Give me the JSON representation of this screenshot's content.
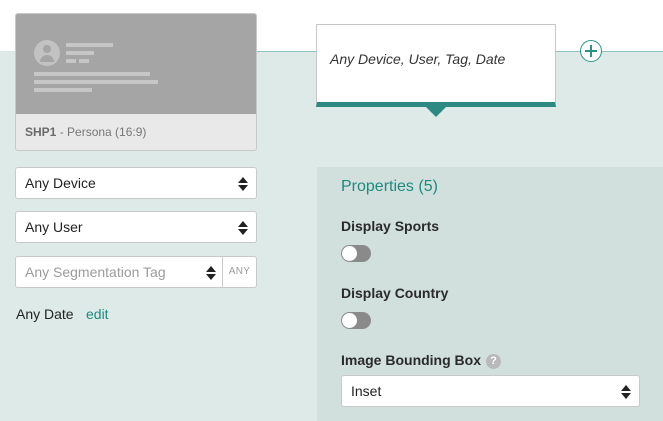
{
  "card": {
    "id": "SHP1",
    "caption_rest": " - Persona (16:9)"
  },
  "filters": {
    "device": "Any Device",
    "user": "Any User",
    "segmentation_placeholder": "Any Segmentation Tag",
    "any_badge": "ANY",
    "date": "Any Date",
    "edit": "edit"
  },
  "tooltip": {
    "text": "Any Device, User, Tag, Date"
  },
  "properties": {
    "title": "Properties (5)",
    "display_sports": {
      "label": "Display Sports",
      "enabled": false
    },
    "display_country": {
      "label": "Display Country",
      "enabled": false
    },
    "bounding_box": {
      "label": "Image Bounding Box",
      "help": "?",
      "value": "Inset"
    }
  },
  "colors": {
    "accent": "#1d8a80",
    "band": "#ddeae8",
    "panel": "#d1e0dd"
  }
}
